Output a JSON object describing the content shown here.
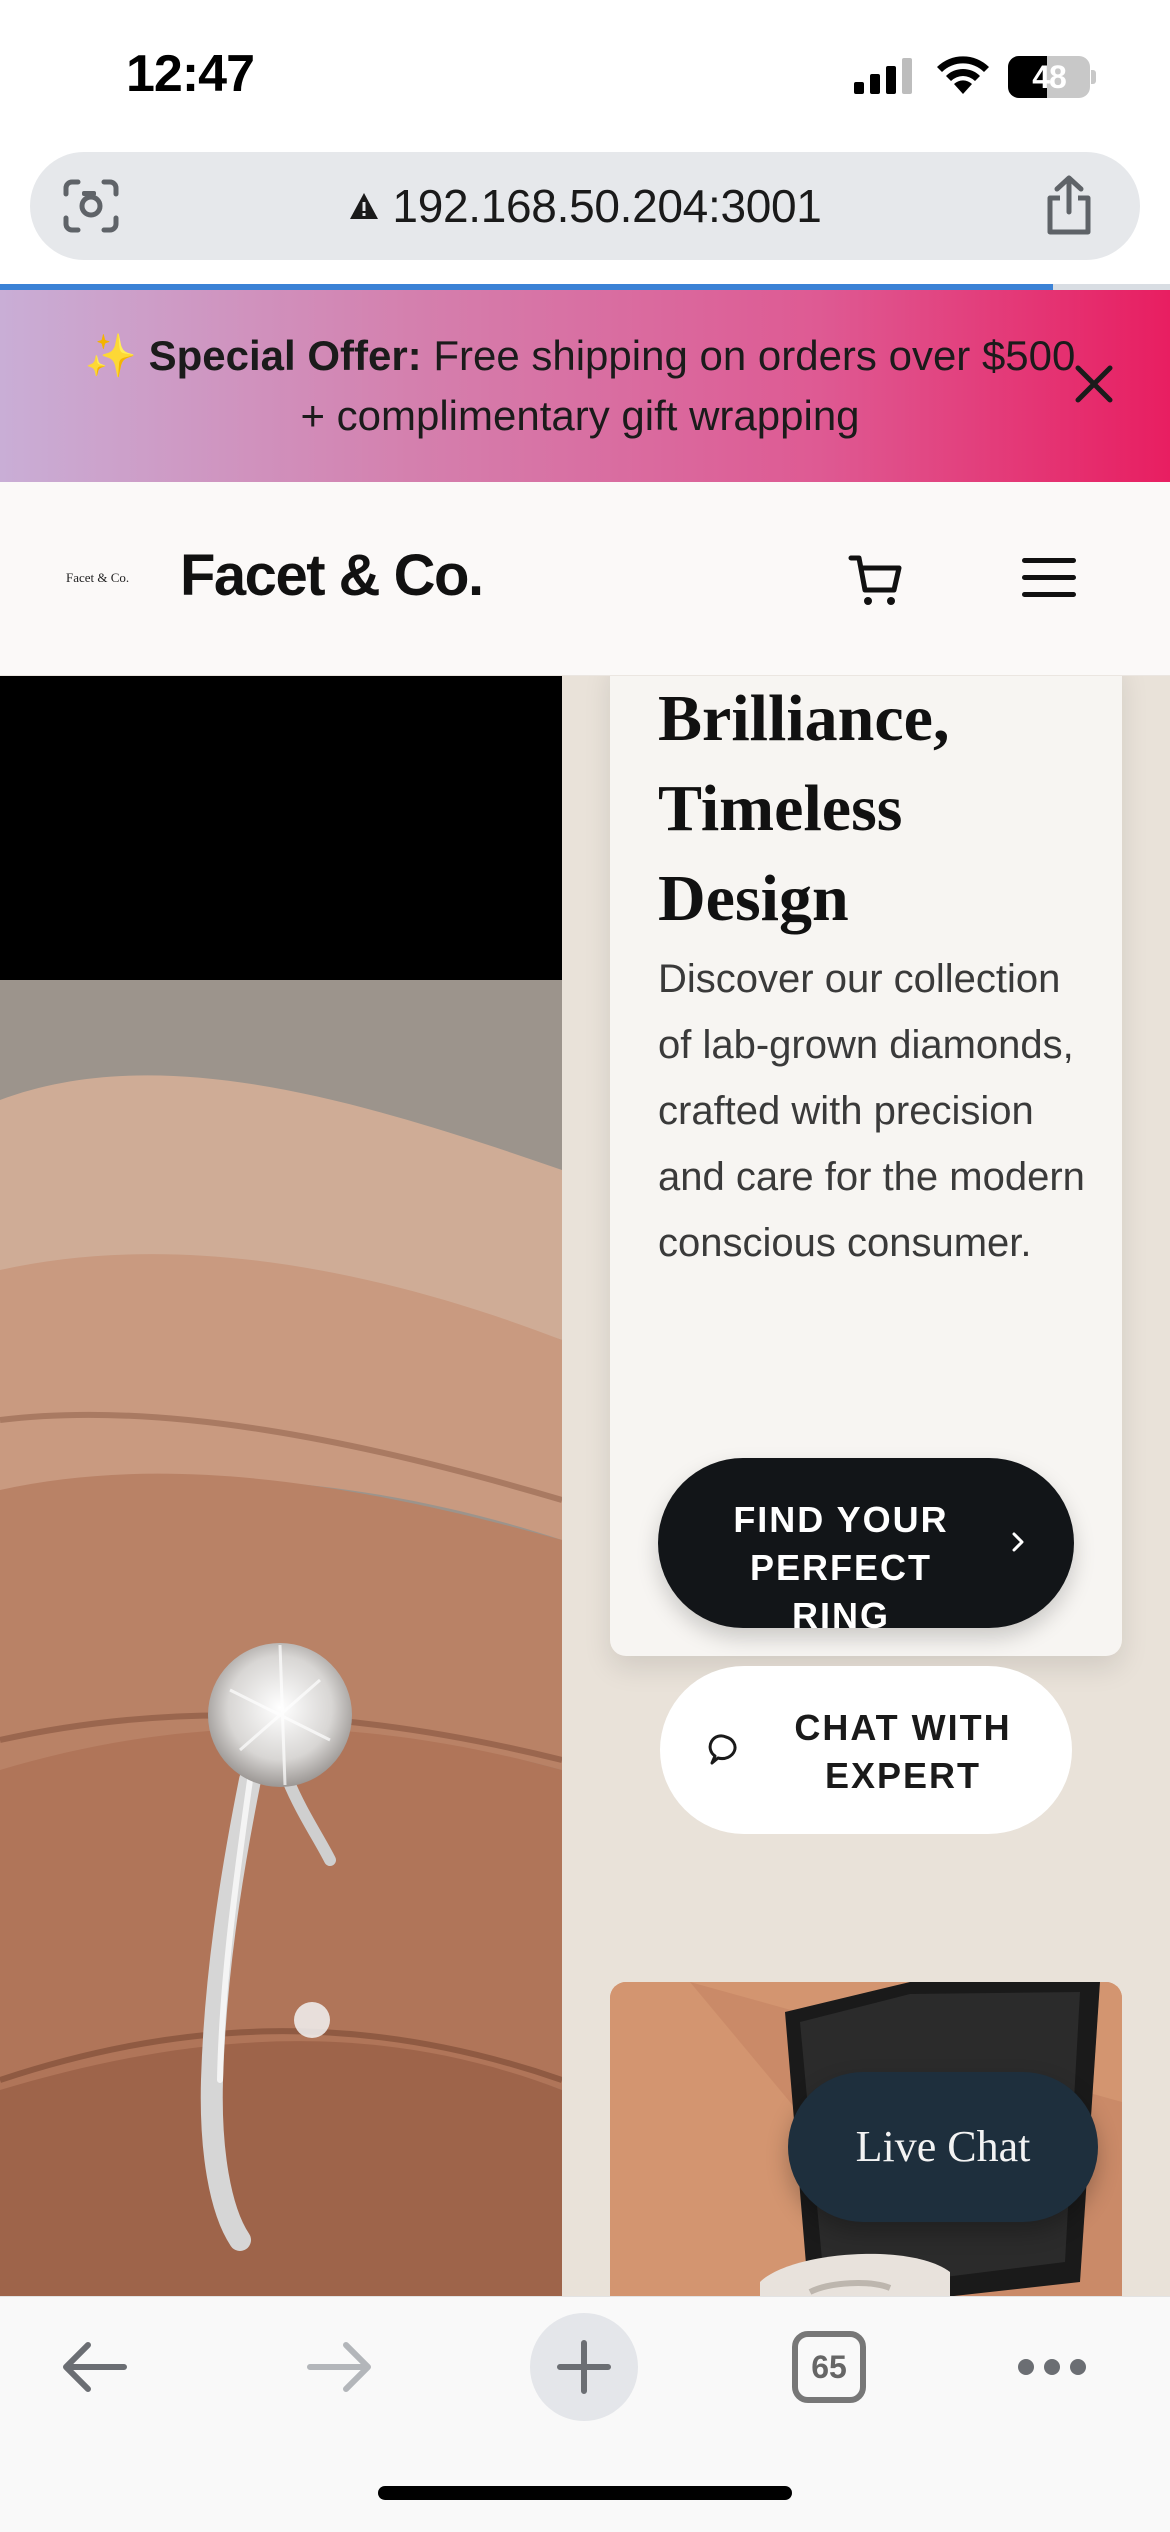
{
  "status_bar": {
    "time": "12:47",
    "battery": "48",
    "battery_level": 0.48
  },
  "browser": {
    "url": "192.168.50.204:3001",
    "load_progress": 0.9,
    "tabs_count": "65"
  },
  "promo": {
    "emoji": "✨",
    "label": "Special Offer:",
    "text": "Free shipping on orders over $500 + complimentary gift wrapping"
  },
  "header": {
    "logo_small": "Facet & Co.",
    "brand": "Facet & Co."
  },
  "hero": {
    "title": "Brilliance, Timeless Design",
    "description": "Discover our collection of lab-grown diamonds, crafted with precision and care for the modern conscious consumer.",
    "primary_cta": "FIND YOUR PERFECT RING",
    "secondary_cta": "CHAT WITH EXPERT"
  },
  "live_chat": {
    "label": "Live Chat"
  },
  "colors": {
    "promo_gradient_start": "#c9aed6",
    "promo_gradient_end": "#e81e61",
    "primary_button": "#121518",
    "live_chat_bg": "#1e2f3d",
    "progress_blue": "#3b82d6"
  },
  "icons": {
    "url_left": "screen-capture-icon",
    "url_warning": "warning-icon",
    "share": "share-icon",
    "cart": "cart-icon",
    "menu": "hamburger-menu-icon",
    "close": "close-icon",
    "chat": "chat-bubble-icon",
    "back": "arrow-left-icon",
    "forward": "arrow-right-icon",
    "new_tab": "plus-icon",
    "more": "more-dots-icon"
  }
}
